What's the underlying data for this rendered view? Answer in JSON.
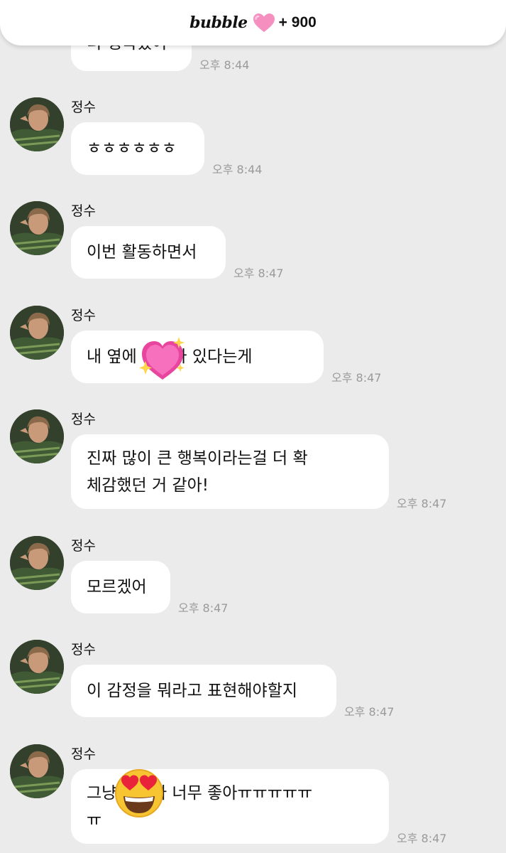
{
  "header": {
    "brand": "bubble",
    "points": "+ 900"
  },
  "colors": {
    "background": "#ebebeb",
    "bubble": "#ffffff",
    "heart_pink": "#f48fc0",
    "timestamp": "#9a9a9a"
  },
  "messages": [
    {
      "sender": "",
      "lines": [
        "더 행복했어"
      ],
      "time": "오후 8:44"
    },
    {
      "sender": "정수",
      "lines": [
        "ㅎㅎㅎㅎㅎㅎ"
      ],
      "time": "오후 8:44"
    },
    {
      "sender": "정수",
      "lines": [
        "이번 활동하면서"
      ],
      "time": "오후 8:47"
    },
    {
      "sender": "정수",
      "lines": [
        "내 옆에 누나가 있다는게"
      ],
      "emoji": "sparkling-heart",
      "time": "오후 8:47"
    },
    {
      "sender": "정수",
      "lines": [
        "진짜 많이 큰 행복이라는걸 더 확",
        "체감했던 거 같아!"
      ],
      "time": "오후 8:47"
    },
    {
      "sender": "정수",
      "lines": [
        "모르겠어"
      ],
      "time": "오후 8:47"
    },
    {
      "sender": "정수",
      "lines": [
        "이 감정을 뭐라고 표현해야할지"
      ],
      "time": "오후 8:47"
    },
    {
      "sender": "정수",
      "lines": [
        "그냥 누나가 너무 좋아ㅠㅠㅠㅠㅠ",
        "ㅠ"
      ],
      "emoji": "heart-eyes-face",
      "time": "오후 8:47"
    }
  ]
}
